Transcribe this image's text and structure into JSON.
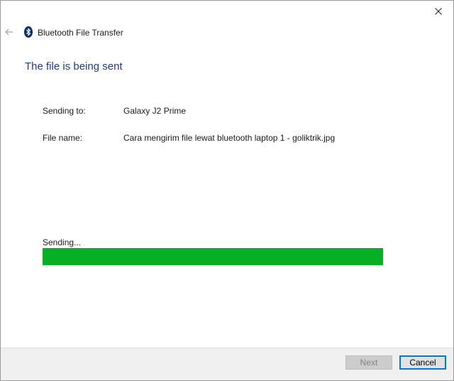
{
  "window": {
    "title": "Bluetooth File Transfer",
    "close_icon": "close-icon",
    "back_icon": "back-arrow-icon",
    "app_icon": "bluetooth-icon"
  },
  "main": {
    "heading": "The file is being sent",
    "sending_to_label": "Sending to:",
    "sending_to_value": "Galaxy J2 Prime",
    "file_name_label": "File name:",
    "file_name_value": "Cara mengirim file lewat bluetooth laptop 1 - goliktrik.jpg",
    "status_text": "Sending...",
    "progress_fraction": 1.0
  },
  "footer": {
    "next_label": "Next",
    "next_enabled": false,
    "cancel_label": "Cancel"
  },
  "colors": {
    "heading": "#1f3d8a",
    "progress": "#06b025",
    "focus_border": "#0078d7"
  }
}
